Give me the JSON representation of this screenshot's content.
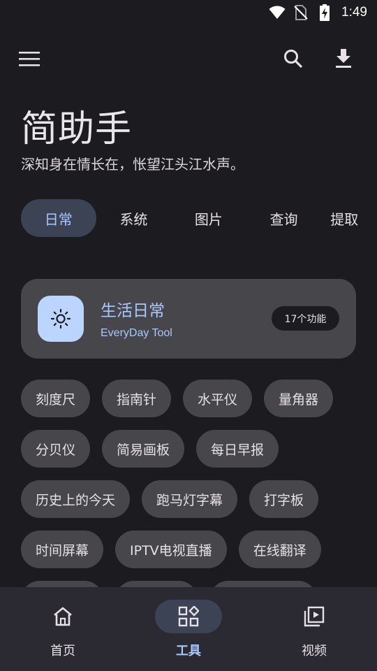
{
  "status_bar": {
    "time": "1:49",
    "icons": [
      "wifi-icon",
      "no-sim-icon",
      "battery-charging-icon"
    ]
  },
  "app_bar": {
    "menu_icon": "menu-icon",
    "search_icon": "search-icon",
    "download_icon": "download-icon"
  },
  "header": {
    "title": "简助手",
    "subtitle": "深知身在情长在，怅望江头江水声。"
  },
  "tabs": [
    {
      "label": "日常",
      "active": true
    },
    {
      "label": "系统",
      "active": false
    },
    {
      "label": "图片",
      "active": false
    },
    {
      "label": "查询",
      "active": false
    },
    {
      "label": "提取",
      "active": false
    }
  ],
  "category_card": {
    "icon": "sun-icon",
    "title": "生活日常",
    "subtitle": "EveryDay Tool",
    "count": "17个功能"
  },
  "tools": {
    "row1": [
      "刻度尺",
      "指南针",
      "水平仪",
      "量角器"
    ],
    "row2": [
      "分贝仪",
      "简易画板",
      "每日早报"
    ],
    "row3": [
      "历史上的今天",
      "跑马灯字幕",
      "打字板"
    ],
    "row4": [
      "时间屏幕",
      "IPTV电视直播",
      "在线翻译"
    ]
  },
  "bottom_nav": [
    {
      "label": "首页",
      "icon": "home-icon",
      "active": false
    },
    {
      "label": "工具",
      "icon": "widgets-icon",
      "active": true
    },
    {
      "label": "视频",
      "icon": "video-library-icon",
      "active": false
    }
  ],
  "colors": {
    "background": "#1c1b1f",
    "accent": "#aac7ff",
    "chip": "#46464b",
    "active_pill": "#3b4354",
    "nav_background": "#2b2a33"
  }
}
